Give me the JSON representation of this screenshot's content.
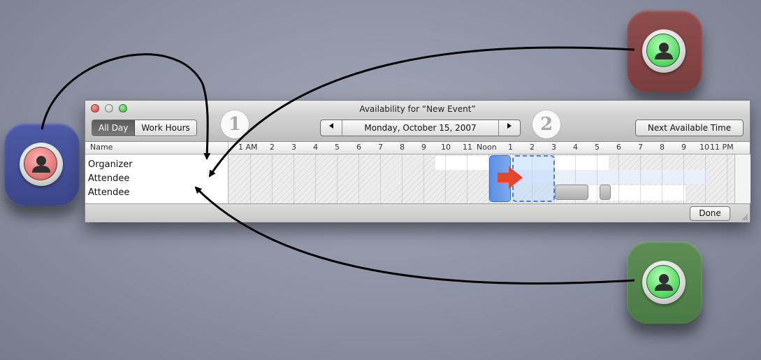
{
  "window": {
    "title": "Availability for “New Event”",
    "view_toggle": [
      "All Day",
      "Work Hours"
    ],
    "selected_view": "All Day",
    "date": "Monday, October 15, 2007",
    "prev_icon": "triangle-left-icon",
    "next_icon": "triangle-right-icon",
    "next_available_label": "Next Available Time",
    "done_label": "Done",
    "step_badges": [
      "1",
      "2"
    ]
  },
  "grid": {
    "name_header": "Name",
    "hours": [
      "1 AM",
      "2",
      "3",
      "4",
      "5",
      "6",
      "7",
      "8",
      "9",
      "10",
      "11",
      "Noon",
      "1",
      "2",
      "3",
      "4",
      "5",
      "6",
      "7",
      "8",
      "9",
      "10",
      "11 PM"
    ],
    "attendees": [
      "Organizer",
      "Attendee",
      "Attendee"
    ]
  },
  "diagram": {
    "participants": [
      {
        "role": "organizer",
        "icon": "person-icon",
        "tile_color": "#4a56a0",
        "badge_color": "#e47b7b"
      },
      {
        "role": "attendee",
        "icon": "person-icon",
        "tile_color": "#8a4a4a",
        "badge_color": "#5fdc6b"
      },
      {
        "role": "attendee",
        "icon": "person-icon",
        "tile_color": "#5a8a52",
        "badge_color": "#5fdc6b"
      }
    ],
    "arrow_color": "#000000",
    "move_arrow_color": "#e5452f",
    "meeting_color": "#5a8fe2"
  }
}
